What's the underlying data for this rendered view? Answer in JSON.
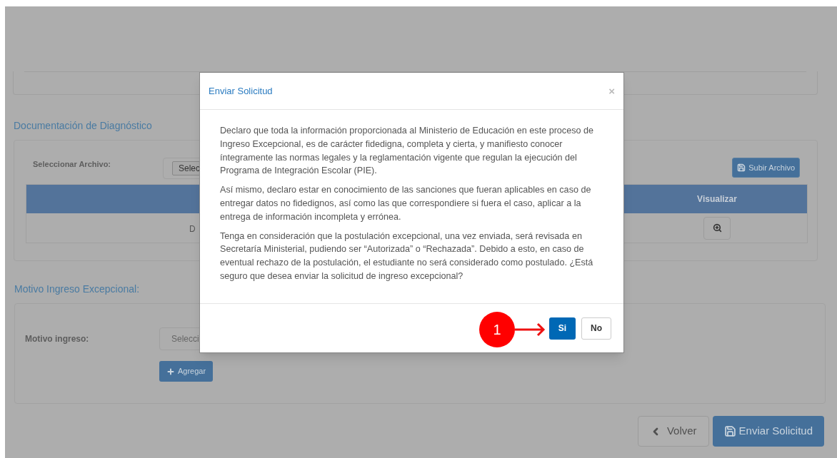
{
  "document_section": {
    "title": "Documentación de Diagnóstico",
    "file_label": "Seleccionar Archivo:",
    "file_button": "Selec",
    "upload_button": "Subir Archivo",
    "table": {
      "columns": [
        {},
        {
          "label": "Visualizar"
        }
      ],
      "rows": [
        {
          "cell_1": "D"
        }
      ]
    }
  },
  "reason_section": {
    "title": "Motivo Ingreso Excepcional:",
    "label": "Motivo ingreso:",
    "select_value": "Selecci",
    "add_button": "Agregar"
  },
  "footer_buttons": [
    {
      "label": "Volver",
      "kind": "back"
    },
    {
      "label": "Enviar Solicitud",
      "kind": "submit"
    }
  ],
  "dialog": {
    "title": "Enviar Solicitud",
    "close": "×",
    "paragraphs": [
      "Declaro que toda la información proporcionada al Ministerio de Educación en este proceso de Ingreso Excepcional, es de carácter fidedigna, completa y cierta, y manifiesto conocer íntegramente las normas legales y la reglamentación vigente que regulan la ejecución del Programa de Integración Escolar (PIE).",
      "Así mismo, declaro estar en conocimiento de las sanciones que fueran aplicables en caso de entregar datos no fidedignos, así como las que correspondiere si fuera el caso, aplicar a la entrega de información incompleta y errónea.",
      "Tenga en consideración que la postulación excepcional, una vez enviada, será revisada en Secretaría Ministerial, pudiendo ser “Autorizada” o “Rechazada”. Debido a esto, en caso de eventual rechazo de la postulación, el estudiante no será considerado como postulado. ¿Está seguro que desea enviar la solicitud de ingreso excepcional?"
    ],
    "buttons": [
      {
        "label": "Si",
        "kind": "primary"
      },
      {
        "label": "No",
        "kind": "default"
      }
    ]
  },
  "annotation": {
    "number": "1"
  }
}
